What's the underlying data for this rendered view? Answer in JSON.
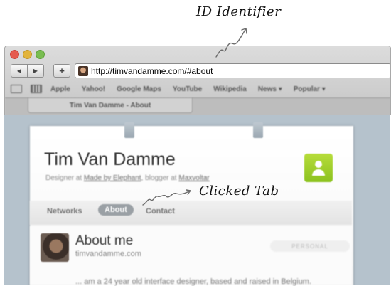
{
  "annotations": {
    "id_identifier": "ID Identifier",
    "clicked_tab": "Clicked Tab"
  },
  "browser": {
    "url": "http://timvandamme.com/#about",
    "bookmarks": [
      "Apple",
      "Yahoo!",
      "Google Maps",
      "YouTube",
      "Wikipedia",
      "News ▾",
      "Popular ▾"
    ],
    "tab_title": "Tim Van Damme - About"
  },
  "page": {
    "name": "Tim Van Damme",
    "tagline_prefix": "Designer at",
    "tagline_company": "Made by Elephant",
    "tagline_mid": ", blogger at",
    "tagline_blog": "Maxvoltar",
    "tabs": [
      "Networks",
      "About",
      "Contact"
    ],
    "active_tab": "About",
    "section_title": "About me",
    "section_sub": "timvandamme.com",
    "badge": "PERSONAL",
    "body_start": "... am a 24 year old interface designer, based and raised in Belgium."
  },
  "colors": {
    "page_bg": "#b5c2cc",
    "active_tab_bg": "#9aa0a5",
    "contact_icon": "#8cc21f"
  }
}
